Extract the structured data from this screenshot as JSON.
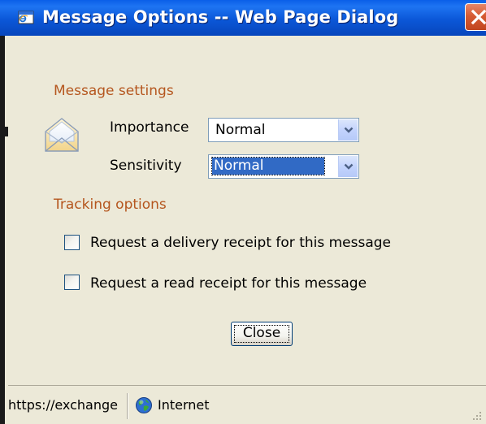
{
  "window": {
    "title": "Message Options -- Web Page Dialog",
    "accent_color": "#0A5FE8",
    "title_icon": "ie-window-icon",
    "close_icon": "close-x-icon"
  },
  "message_settings": {
    "heading": "Message settings",
    "icon": "envelope-icon",
    "importance": {
      "label": "Importance",
      "selected": "Normal"
    },
    "sensitivity": {
      "label": "Sensitivity",
      "selected": "Normal"
    }
  },
  "tracking_options": {
    "heading": "Tracking options",
    "delivery_receipt": {
      "label": "Request a delivery receipt for this message",
      "checked": false
    },
    "read_receipt": {
      "label": "Request a read receipt for this message",
      "checked": false
    }
  },
  "buttons": {
    "close_label": "Close"
  },
  "statusbar": {
    "url": "https://exchange",
    "zone_icon": "globe-icon",
    "zone": "Internet"
  },
  "colors": {
    "section_heading": "#B5561E",
    "dialog_background": "#ECE9D8",
    "selection_highlight": "#316AC5"
  }
}
